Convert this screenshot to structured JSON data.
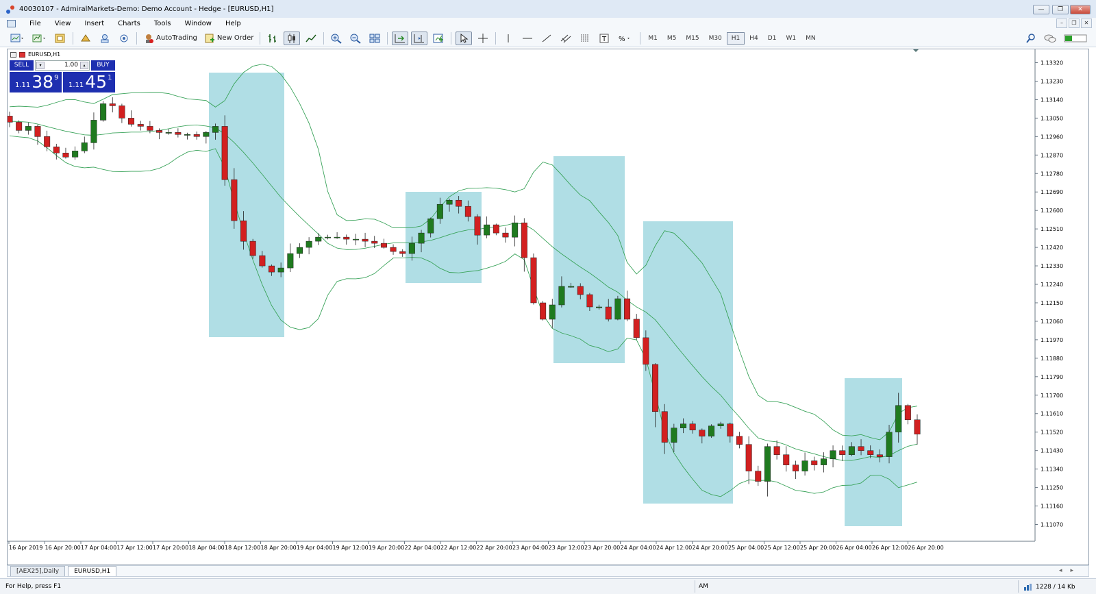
{
  "window": {
    "title": "40030107 - AdmiralMarkets-Demo: Demo Account - Hedge - [EURUSD,H1]",
    "controls": [
      "—",
      "❐",
      "✕"
    ]
  },
  "menu": {
    "items": [
      "File",
      "View",
      "Insert",
      "Charts",
      "Tools",
      "Window",
      "Help"
    ],
    "mdi_controls": [
      "–",
      "❐",
      "✕"
    ]
  },
  "toolbar": {
    "autotrading_label": "AutoTrading",
    "new_order_label": "New Order",
    "timeframes": [
      "M1",
      "M5",
      "M15",
      "M30",
      "H1",
      "H4",
      "D1",
      "W1",
      "MN"
    ],
    "active_timeframe": "H1"
  },
  "chart": {
    "symbol_label": "EURUSD,H1",
    "colors": {
      "bull": "#1f7a1f",
      "bear": "#d22020",
      "band": "#3aa35a",
      "highlight": "#8fd0da"
    },
    "trade_panel": {
      "sell_label": "SELL",
      "buy_label": "BUY",
      "volume": "1.00",
      "sell_prefix": "1.11",
      "sell_big": "38",
      "sell_sup": "9",
      "buy_prefix": "1.11",
      "buy_big": "45",
      "buy_sup": "1"
    },
    "price_axis": [
      "1.13320",
      "1.13230",
      "1.13140",
      "1.13050",
      "1.12960",
      "1.12870",
      "1.12780",
      "1.12690",
      "1.12600",
      "1.12510",
      "1.12420",
      "1.12330",
      "1.12240",
      "1.12150",
      "1.12060",
      "1.11970",
      "1.11880",
      "1.11790",
      "1.11700",
      "1.11610",
      "1.11520",
      "1.11430",
      "1.11340",
      "1.11250",
      "1.11160",
      "1.11070"
    ],
    "time_axis": [
      "16 Apr 2019",
      "16 Apr 20:00",
      "17 Apr 04:00",
      "17 Apr 12:00",
      "17 Apr 20:00",
      "18 Apr 04:00",
      "18 Apr 12:00",
      "18 Apr 20:00",
      "19 Apr 04:00",
      "19 Apr 12:00",
      "19 Apr 20:00",
      "22 Apr 04:00",
      "22 Apr 12:00",
      "22 Apr 20:00",
      "23 Apr 04:00",
      "23 Apr 12:00",
      "23 Apr 20:00",
      "24 Apr 04:00",
      "24 Apr 12:00",
      "24 Apr 20:00",
      "25 Apr 04:00",
      "25 Apr 12:00",
      "25 Apr 20:00",
      "26 Apr 04:00",
      "26 Apr 12:00",
      "26 Apr 20:00"
    ]
  },
  "chart_data": {
    "type": "candlestick",
    "symbol": "EURUSD",
    "timeframe": "H1",
    "y_ticks": [
      1.1332,
      1.1323,
      1.1314,
      1.1305,
      1.1296,
      1.1287,
      1.1278,
      1.1269,
      1.126,
      1.1251,
      1.1242,
      1.1233,
      1.1224,
      1.1215,
      1.1206,
      1.1197,
      1.1188,
      1.1179,
      1.117,
      1.1161,
      1.1152,
      1.1143,
      1.1134,
      1.1125,
      1.1116,
      1.1107
    ],
    "close_path": [
      1.1303,
      1.1299,
      1.1301,
      1.1296,
      1.1291,
      1.1288,
      1.1286,
      1.1289,
      1.1293,
      1.1304,
      1.1312,
      1.1311,
      1.1305,
      1.1302,
      1.1301,
      1.1299,
      1.1298,
      1.1298,
      1.1297,
      1.1297,
      1.1296,
      1.1298,
      1.1301,
      1.1275,
      1.1255,
      1.1245,
      1.1238,
      1.1233,
      1.123,
      1.1232,
      1.1239,
      1.1242,
      1.1245,
      1.1247,
      1.1247,
      1.1247,
      1.1246,
      1.1246,
      1.1245,
      1.1244,
      1.1242,
      1.124,
      1.1239,
      1.1244,
      1.1249,
      1.1256,
      1.1263,
      1.1265,
      1.1262,
      1.1257,
      1.1248,
      1.1253,
      1.1249,
      1.1247,
      1.1254,
      1.1237,
      1.1215,
      1.1207,
      1.1214,
      1.1223,
      1.1223,
      1.1219,
      1.1213,
      1.1213,
      1.1207,
      1.1217,
      1.1207,
      1.1198,
      1.1185,
      1.1162,
      1.1147,
      1.1154,
      1.1156,
      1.1153,
      1.115,
      1.1155,
      1.1156,
      1.115,
      1.1146,
      1.1133,
      1.1128,
      1.1145,
      1.1141,
      1.1136,
      1.1133,
      1.1138,
      1.1136,
      1.1139,
      1.1143,
      1.1141,
      1.1145,
      1.1143,
      1.1141,
      1.114,
      1.1152,
      1.1165,
      1.1158,
      1.1151
    ],
    "highlight_zones": 5,
    "indicators": [
      "Bollinger Bands"
    ]
  },
  "tabs": {
    "items": [
      "[AEX25],Daily",
      "EURUSD,H1"
    ],
    "active": "EURUSD,H1",
    "nav": "◂▸"
  },
  "status": {
    "help_text": "For Help, press F1",
    "mid_text": "AM",
    "traffic": "1228 / 14 Kb"
  }
}
